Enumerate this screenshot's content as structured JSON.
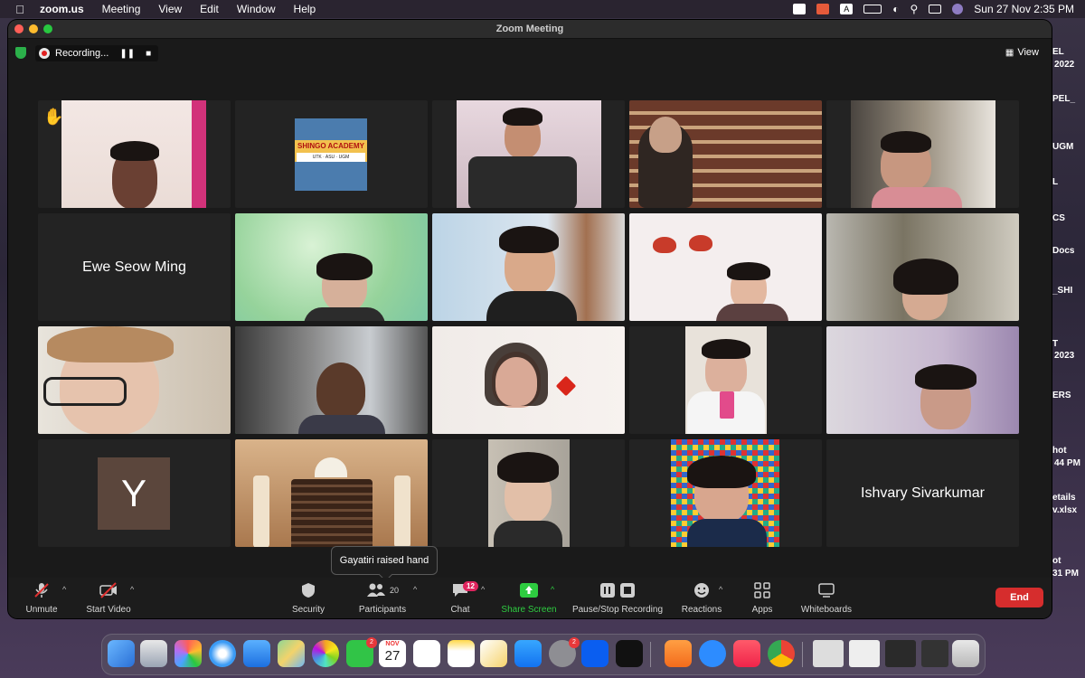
{
  "menubar": {
    "app": "zoom.us",
    "menus": [
      "Meeting",
      "View",
      "Edit",
      "Window",
      "Help"
    ],
    "datetime": "Sun 27 Nov  2:35 PM"
  },
  "window": {
    "title": "Zoom Meeting"
  },
  "recording": {
    "label": "Recording..."
  },
  "view_button": {
    "label": "View"
  },
  "tiles": [
    {
      "kind": "video",
      "raised_hand": true
    },
    {
      "kind": "video",
      "sign": "SHINGO ACADEMY"
    },
    {
      "kind": "video"
    },
    {
      "kind": "video"
    },
    {
      "kind": "video"
    },
    {
      "kind": "name",
      "name": "Ewe Seow Ming"
    },
    {
      "kind": "video"
    },
    {
      "kind": "video"
    },
    {
      "kind": "video"
    },
    {
      "kind": "video"
    },
    {
      "kind": "video"
    },
    {
      "kind": "video",
      "active": true
    },
    {
      "kind": "video"
    },
    {
      "kind": "video"
    },
    {
      "kind": "video"
    },
    {
      "kind": "avatar",
      "initial": "Y"
    },
    {
      "kind": "video"
    },
    {
      "kind": "video"
    },
    {
      "kind": "video"
    },
    {
      "kind": "name",
      "name": "Ishvary Sivarkumar"
    }
  ],
  "notification": {
    "text": "Gayatiri raised hand"
  },
  "toolbar": {
    "unmute": "Unmute",
    "start_video": "Start Video",
    "security": "Security",
    "participants": "Participants",
    "participants_count": "20",
    "chat": "Chat",
    "chat_badge": "12",
    "share_screen": "Share Screen",
    "pause_stop": "Pause/Stop Recording",
    "reactions": "Reactions",
    "apps": "Apps",
    "whiteboards": "Whiteboards",
    "end": "End"
  },
  "desktop_fragments": [
    "EL",
    "2022",
    "PEL_",
    "UGM",
    "L",
    "CS",
    "Docs",
    "_SHI",
    "T",
    "2023",
    "ERS",
    "hot",
    "44 PM",
    "etails",
    "v.xlsx",
    "ot",
    "31 PM"
  ],
  "dock": {
    "calendar_month": "NOV",
    "calendar_day": "27",
    "facetime_badge": "2",
    "settings_badge": "2"
  },
  "colors": {
    "active_speaker": "#2ecc40",
    "end_button": "#d62d2d",
    "share_screen": "#2ecc40",
    "badge": "#e0245e"
  }
}
